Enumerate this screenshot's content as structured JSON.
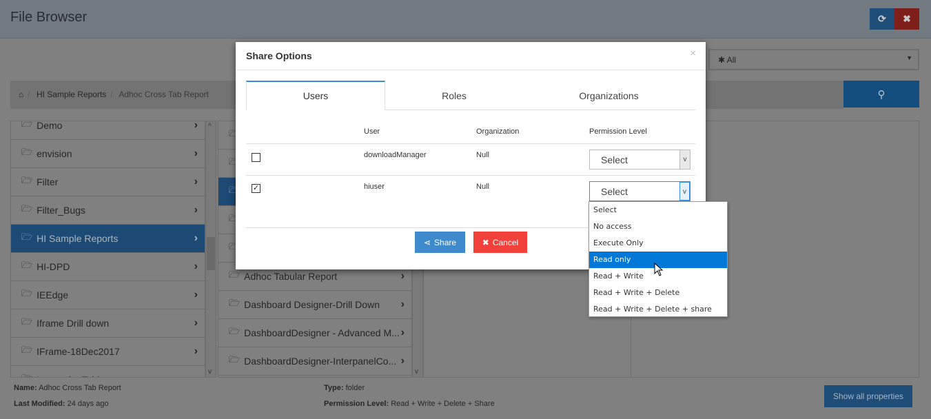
{
  "header": {
    "title": "File Browser",
    "refresh_icon": "refresh-icon",
    "close_icon": "close-icon",
    "colors": {
      "refresh": "#1f4e79",
      "close": "#7f1f1a"
    }
  },
  "filter": {
    "value": "✱ All"
  },
  "breadcrumb": {
    "items": [
      "HI Sample Reports",
      "Adhoc Cross Tab Report"
    ]
  },
  "left_list": {
    "items": [
      "Demo",
      "envision",
      "Filter",
      "Filter_Bugs",
      "HI Sample Reports",
      "HI-DPD",
      "IEEdge",
      "Iframe Drill down",
      "IFrame-18Dec2017",
      "Image_in_Table"
    ],
    "active": "HI Sample Reports"
  },
  "middle_list": {
    "items": [
      "",
      "",
      "",
      "",
      "",
      "Adhoc Tabular Report",
      "Dashboard Designer-Drill Down",
      "DashboardDesigner - Advanced M...",
      "DashboardDesigner-InterpanelCo..."
    ]
  },
  "footer": {
    "name_label": "Name:",
    "name": "Adhoc Cross Tab Report",
    "modified_label": "Last Modified:",
    "modified": "24 days ago",
    "type_label": "Type:",
    "type": "folder",
    "perm_label": "Permission Level:",
    "perm": "Read + Write + Delete + Share",
    "show_all": "Show all properties"
  },
  "modal": {
    "title": "Share Options",
    "close": "×",
    "tabs": [
      {
        "label": "Users",
        "active": true
      },
      {
        "label": "Roles"
      },
      {
        "label": "Organizations"
      }
    ],
    "columns": [
      "User",
      "Organization",
      "Permission Level"
    ],
    "rows": [
      {
        "user": "downloadManager",
        "org": "Null",
        "perm": "Select",
        "checked": false
      },
      {
        "user": "hiuser",
        "org": "Null",
        "perm": "Select",
        "checked": true
      }
    ],
    "share": "Share",
    "cancel": "Cancel",
    "colors": {
      "share": "#3e8acc",
      "cancel": "#f2403a"
    }
  },
  "dropdown": {
    "options": [
      "Select",
      "No access",
      "Execute Only",
      "Read only",
      "Read + Write",
      "Read + Write + Delete",
      "Read + Write + Delete + share"
    ],
    "highlighted": "Read only"
  }
}
